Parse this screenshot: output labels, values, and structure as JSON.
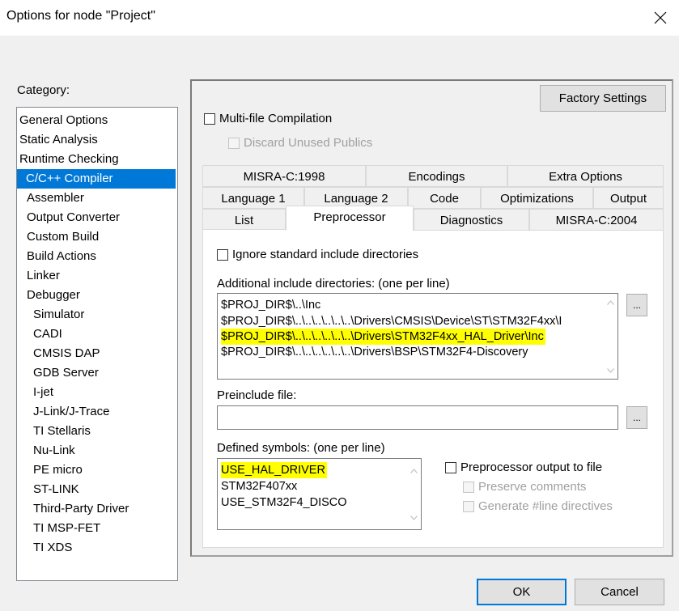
{
  "window": {
    "title": "Options for node \"Project\""
  },
  "category": {
    "label": "Category:",
    "items": [
      "General Options",
      "Static Analysis",
      "Runtime Checking",
      "C/C++ Compiler",
      "Assembler",
      "Output Converter",
      "Custom Build",
      "Build Actions",
      "Linker",
      "Debugger",
      "Simulator",
      "CADI",
      "CMSIS DAP",
      "GDB Server",
      "I-jet",
      "J-Link/J-Trace",
      "TI Stellaris",
      "Nu-Link",
      "PE micro",
      "ST-LINK",
      "Third-Party Driver",
      "TI MSP-FET",
      "TI XDS"
    ],
    "selected_index": 3
  },
  "buttons": {
    "factory_settings": "Factory Settings",
    "ok": "OK",
    "cancel": "Cancel",
    "browse": "..."
  },
  "options": {
    "multi_file": "Multi-file Compilation",
    "discard_unused": "Discard Unused Publics"
  },
  "tabs": {
    "row1": [
      "MISRA-C:1998",
      "Encodings",
      "Extra Options"
    ],
    "row2": [
      "Language 1",
      "Language 2",
      "Code",
      "Optimizations",
      "Output"
    ],
    "row3": [
      "List",
      "Preprocessor",
      "Diagnostics",
      "MISRA-C:2004"
    ],
    "active": "Preprocessor"
  },
  "preprocessor": {
    "ignore_std": "Ignore standard include directories",
    "include_label": "Additional include directories: (one per line)",
    "include_dirs": [
      "$PROJ_DIR$\\..\\Inc",
      "$PROJ_DIR$\\..\\..\\..\\..\\..\\..\\Drivers\\CMSIS\\Device\\ST\\STM32F4xx\\I",
      "$PROJ_DIR$\\..\\..\\..\\..\\..\\..\\Drivers\\STM32F4xx_HAL_Driver\\Inc",
      "$PROJ_DIR$\\..\\..\\..\\..\\..\\..\\Drivers\\BSP\\STM32F4-Discovery"
    ],
    "include_highlighted_index": 2,
    "preinclude_label": "Preinclude file:",
    "preinclude_value": "",
    "symbols_label": "Defined symbols: (one per line)",
    "symbols": [
      "USE_HAL_DRIVER",
      "STM32F407xx",
      "USE_STM32F4_DISCO"
    ],
    "symbols_highlighted_index": 0,
    "pp_output": "Preprocessor output to file",
    "preserve_comments": "Preserve comments",
    "generate_line": "Generate #line directives"
  },
  "colors": {
    "selection": "#0078d7",
    "highlight": "#ffff00"
  }
}
